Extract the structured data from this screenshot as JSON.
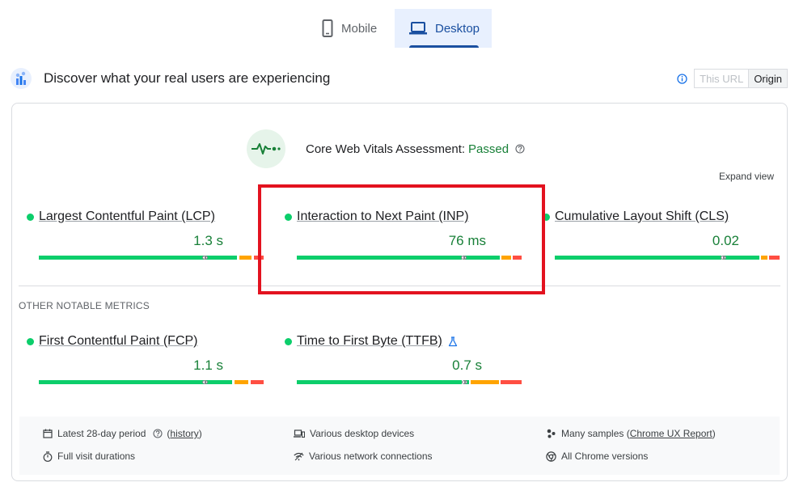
{
  "tabs": [
    {
      "label": "Mobile",
      "icon": "phone-icon"
    },
    {
      "label": "Desktop",
      "icon": "laptop-icon",
      "active": true
    }
  ],
  "header": {
    "title": "Discover what your real users are experiencing",
    "toggle": {
      "this_url": "This URL",
      "origin": "Origin",
      "selected": "Origin"
    }
  },
  "assessment": {
    "label": "Core Web Vitals Assessment:",
    "status": "Passed",
    "expand": "Expand view"
  },
  "core_metrics": [
    {
      "name": "Largest Contentful Paint (LCP)",
      "value": "1.3 s"
    },
    {
      "name": "Interaction to Next Paint (INP)",
      "value": "76 ms"
    },
    {
      "name": "Cumulative Layout Shift (CLS)",
      "value": "0.02"
    }
  ],
  "other_heading": "OTHER NOTABLE METRICS",
  "other_metrics": [
    {
      "name": "First Contentful Paint (FCP)",
      "value": "1.1 s"
    },
    {
      "name": "Time to First Byte (TTFB)",
      "value": "0.7 s",
      "experimental_icon": "flask-icon"
    }
  ],
  "footer": {
    "period": "Latest 28-day period",
    "history_open": "(",
    "history": "history",
    "history_close": ")",
    "devices": "Various desktop devices",
    "samples_prefix": "Many samples (",
    "samples_link": "Chrome UX Report",
    "samples_suffix": ")",
    "durations": "Full visit durations",
    "network": "Various network connections",
    "versions": "All Chrome versions"
  },
  "colors": {
    "good": "#0cce6b",
    "needs_improvement": "#ffa400",
    "poor": "#ff4e42",
    "accent": "#1a4fa0",
    "highlight": "#e3121f"
  }
}
